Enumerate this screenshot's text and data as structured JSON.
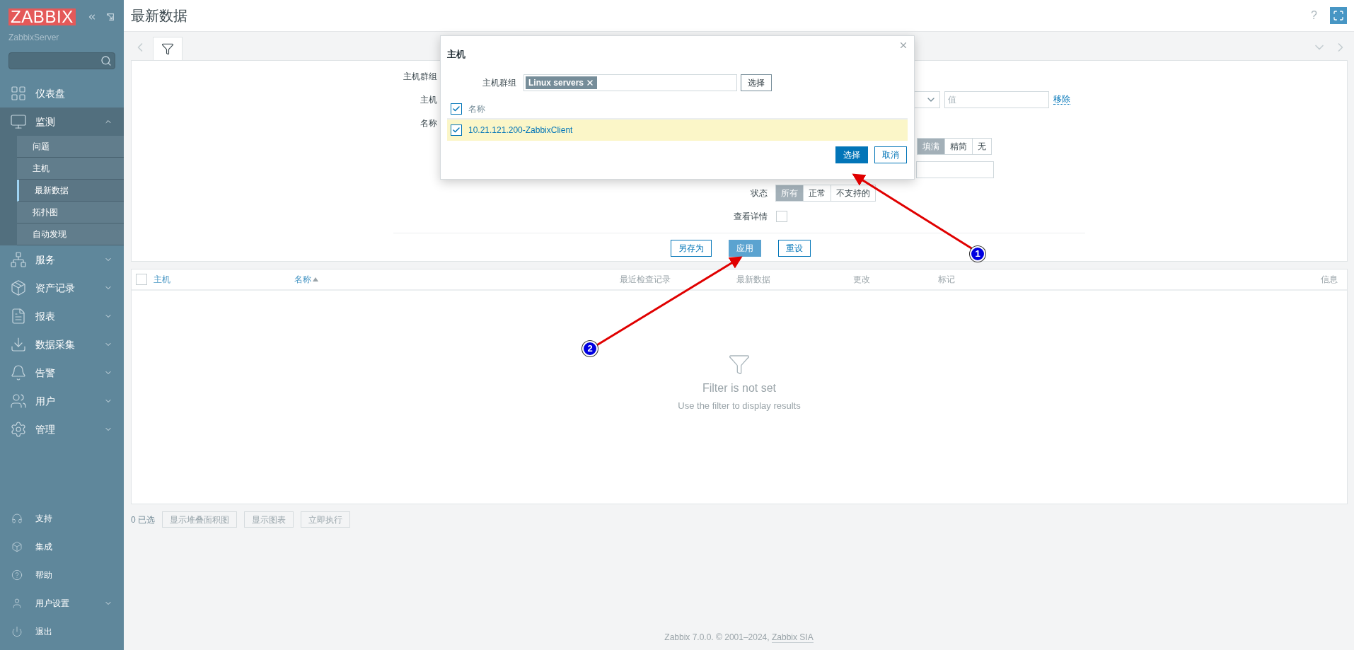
{
  "sidebar": {
    "logo": "ZABBIX",
    "server": "ZabbixServer",
    "menu": [
      {
        "label": "仪表盘",
        "kind": "dashboard"
      },
      {
        "label": "监测",
        "kind": "monitoring",
        "expanded": true,
        "children": [
          {
            "label": "问题",
            "selected": false
          },
          {
            "label": "主机",
            "selected": false
          },
          {
            "label": "最新数据",
            "selected": true
          },
          {
            "label": "拓扑图",
            "selected": false
          },
          {
            "label": "自动发现",
            "selected": false
          }
        ]
      },
      {
        "label": "服务",
        "kind": "services",
        "expanded": false
      },
      {
        "label": "资产记录",
        "kind": "inventory",
        "expanded": false
      },
      {
        "label": "报表",
        "kind": "reports",
        "expanded": false
      },
      {
        "label": "数据采集",
        "kind": "data-collection",
        "expanded": false
      },
      {
        "label": "告警",
        "kind": "alerts",
        "expanded": false
      },
      {
        "label": "用户",
        "kind": "users",
        "expanded": false
      },
      {
        "label": "管理",
        "kind": "admin",
        "expanded": false
      }
    ],
    "bottom_menu": [
      {
        "label": "支持",
        "kind": "support"
      },
      {
        "label": "集成",
        "kind": "integrations"
      },
      {
        "label": "帮助",
        "kind": "help"
      },
      {
        "label": "用户设置",
        "kind": "user-settings",
        "expanded": false
      },
      {
        "label": "退出",
        "kind": "sign-out"
      }
    ]
  },
  "header": {
    "title": "最新数据",
    "help": "?"
  },
  "filter": {
    "left_labels": [
      "主机群组",
      "主机",
      "名称"
    ],
    "tag_value": {
      "placeholder": "值"
    },
    "remove_link": "移除",
    "show_tags": [
      {
        "label": "填满",
        "selected": true
      },
      {
        "label": "精简",
        "selected": false
      },
      {
        "label": "无",
        "selected": false
      }
    ],
    "state_label": "状态",
    "state": [
      {
        "label": "所有",
        "selected": true
      },
      {
        "label": "正常",
        "selected": false
      },
      {
        "label": "不支持的",
        "selected": false
      }
    ],
    "details_label": "查看详情",
    "details_checked": false,
    "buttons": [
      {
        "label": "另存为",
        "kind": "outline"
      },
      {
        "label": "应用",
        "kind": "apply"
      },
      {
        "label": "重设",
        "kind": "outline"
      }
    ]
  },
  "table": {
    "select_all": false,
    "columns": [
      {
        "label": "主机",
        "sortable": true
      },
      {
        "label": "名称",
        "sortable": true,
        "sorted": true
      },
      {
        "label": "最近检查记录",
        "sortable": false
      },
      {
        "label": "最新数据",
        "sortable": false
      },
      {
        "label": "更改",
        "sortable": false
      },
      {
        "label": "标记",
        "sortable": false
      },
      {
        "label": "信息",
        "sortable": false
      }
    ],
    "empty_title": "Filter is not set",
    "empty_text": "Use the filter to display results"
  },
  "selection": {
    "count": "0 已选",
    "buttons": [
      {
        "label": "显示堆叠面积图",
        "disabled": true
      },
      {
        "label": "显示图表",
        "disabled": true
      },
      {
        "label": "立即执行",
        "disabled": true
      }
    ]
  },
  "footer": {
    "text": "Zabbix 7.0.0. © 2001–2024, ",
    "link": "Zabbix SIA"
  },
  "modal": {
    "title": "主机",
    "group_label": "主机群组",
    "group_tag": "Linux servers",
    "select_button": "选择",
    "column": "名称",
    "header_checked": true,
    "rows": [
      {
        "name": "10.21.121.200-ZabbixClient",
        "checked": true
      }
    ],
    "buttons": [
      {
        "label": "选择",
        "kind": "primary"
      },
      {
        "label": "取消",
        "kind": "outline"
      }
    ]
  },
  "annotations": [
    {
      "number": "1"
    },
    {
      "number": "2"
    }
  ]
}
